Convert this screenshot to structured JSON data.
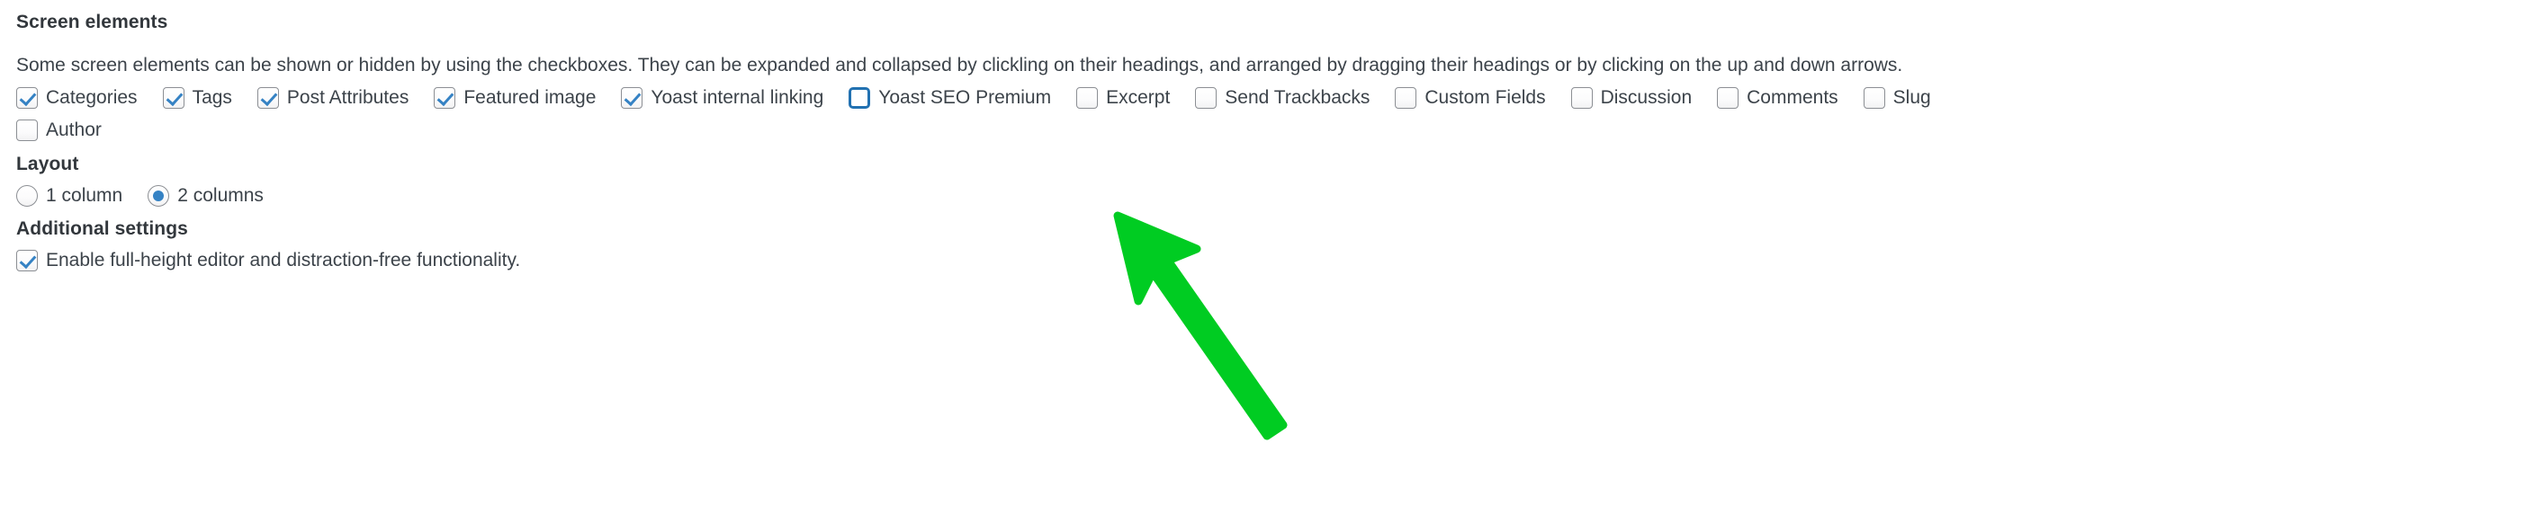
{
  "screen_options": {
    "sections": {
      "screen_elements": {
        "heading": "Screen elements",
        "description": "Some screen elements can be shown or hidden by using the checkboxes. They can be expanded and collapsed by clickling on their headings, and arranged by dragging their headings or by clicking on the up and down arrows.",
        "checkboxes_row1": [
          {
            "label": "Categories",
            "checked": true,
            "focused": false
          },
          {
            "label": "Tags",
            "checked": true,
            "focused": false
          },
          {
            "label": "Post Attributes",
            "checked": true,
            "focused": false
          },
          {
            "label": "Featured image",
            "checked": true,
            "focused": false
          },
          {
            "label": "Yoast internal linking",
            "checked": true,
            "focused": false
          },
          {
            "label": "Yoast SEO Premium",
            "checked": false,
            "focused": true
          },
          {
            "label": "Excerpt",
            "checked": false,
            "focused": false
          },
          {
            "label": "Send Trackbacks",
            "checked": false,
            "focused": false
          },
          {
            "label": "Custom Fields",
            "checked": false,
            "focused": false
          },
          {
            "label": "Discussion",
            "checked": false,
            "focused": false
          },
          {
            "label": "Comments",
            "checked": false,
            "focused": false
          },
          {
            "label": "Slug",
            "checked": false,
            "focused": false
          }
        ],
        "checkboxes_row2": [
          {
            "label": "Author",
            "checked": false,
            "focused": false
          }
        ]
      },
      "layout": {
        "heading": "Layout",
        "options": [
          {
            "label": "1 column",
            "selected": false
          },
          {
            "label": "2 columns",
            "selected": true
          }
        ]
      },
      "additional_settings": {
        "heading": "Additional settings",
        "checkboxes": [
          {
            "label": "Enable full-height editor and distraction-free functionality.",
            "checked": true,
            "focused": false
          }
        ]
      }
    }
  },
  "annotation": {
    "arrow": {
      "icon": "arrow-up-left",
      "color": "#00cc22",
      "points_to": "Yoast SEO Premium"
    }
  },
  "colors": {
    "text": "#3c434a",
    "heading": "#32373c",
    "checkbox_border": "#8c8f94",
    "checkbox_check": "#3582c4",
    "focus_border": "#2271b1",
    "radio_dot": "#3582c4",
    "arrow_green": "#00cc22",
    "background": "#ffffff"
  }
}
